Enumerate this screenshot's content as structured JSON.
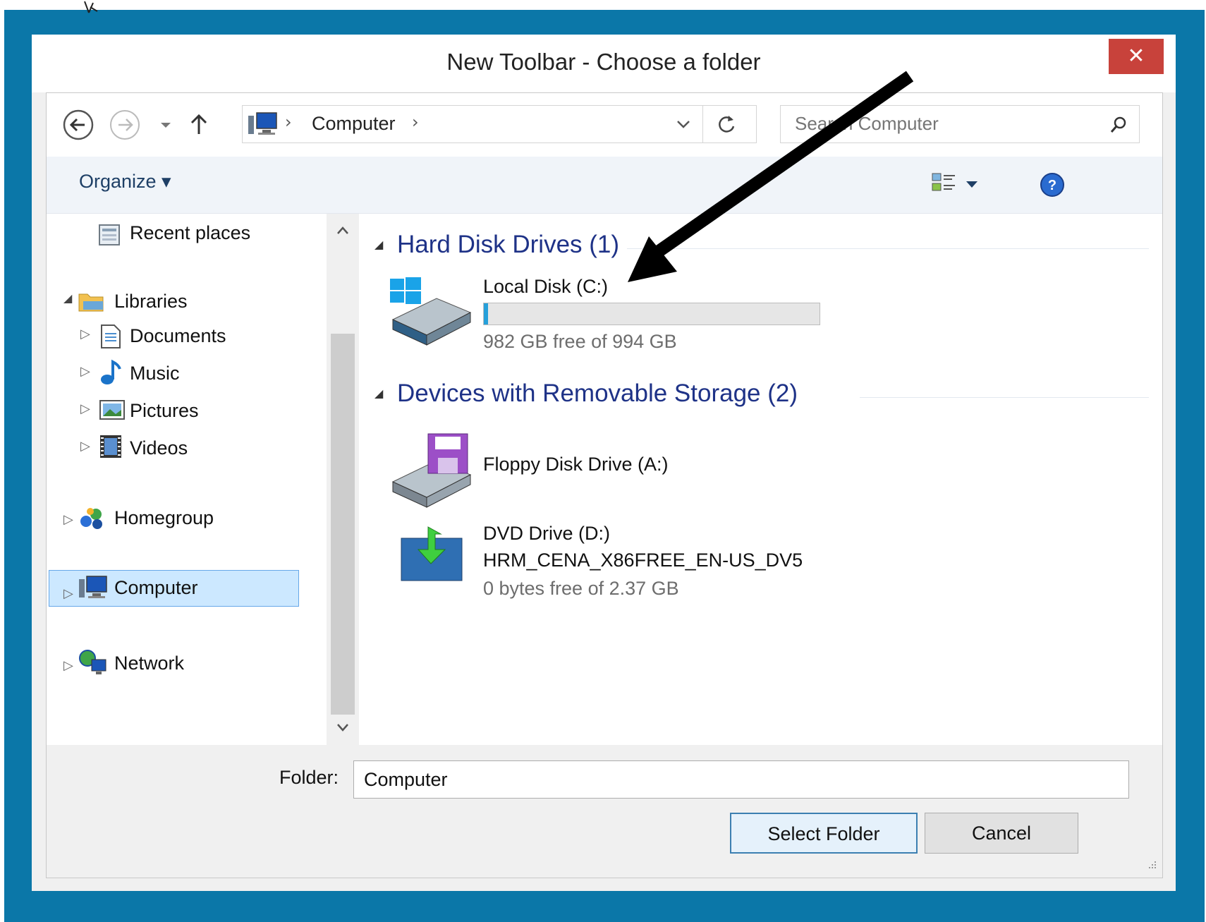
{
  "window": {
    "title": "New Toolbar - Choose a folder",
    "close_label": "✕"
  },
  "address_bar": {
    "path_item": "Computer",
    "separator": "›"
  },
  "search": {
    "placeholder": "Search Computer"
  },
  "command_bar": {
    "organize_label": "Organize ▾"
  },
  "nav_pane": {
    "recent_places": "Recent places",
    "libraries": "Libraries",
    "documents": "Documents",
    "music": "Music",
    "pictures": "Pictures",
    "videos": "Videos",
    "homegroup": "Homegroup",
    "computer": "Computer",
    "network": "Network"
  },
  "content": {
    "hard_disk_header": "Hard Disk Drives (1)",
    "removable_header": "Devices with Removable Storage (2)",
    "drives": {
      "local_disk": {
        "name": "Local Disk (C:)",
        "space": "982 GB free of 994 GB",
        "used_fraction": 0.012
      },
      "floppy": {
        "name": "Floppy Disk Drive (A:)"
      },
      "dvd": {
        "name": "DVD Drive (D:)",
        "label": "HRM_CENA_X86FREE_EN-US_DV5",
        "space": "0 bytes free of 2.37 GB"
      }
    }
  },
  "footer": {
    "folder_label": "Folder:",
    "folder_value": "Computer",
    "select_button": "Select Folder",
    "cancel_button": "Cancel"
  },
  "colors": {
    "desktop": "#0b77a8",
    "close_button": "#c8423b",
    "group_header": "#1e3287",
    "selection": "#cce8ff"
  }
}
